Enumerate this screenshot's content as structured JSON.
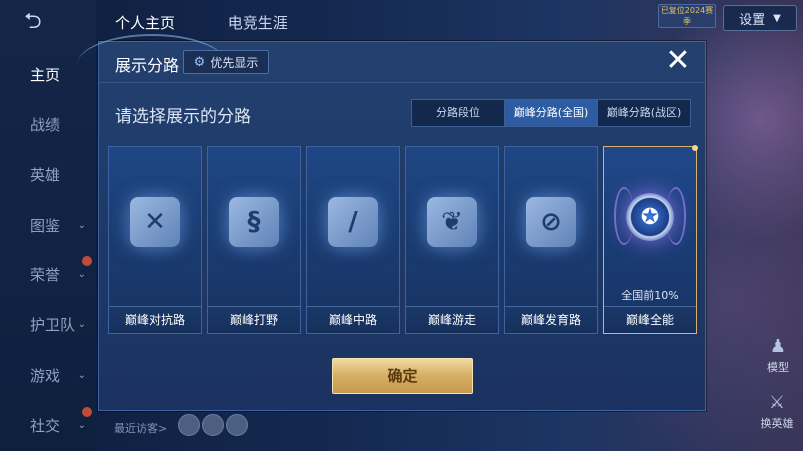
{
  "top_tabs": [
    "个人主页",
    "电竞生涯"
  ],
  "settings": {
    "label": "设置"
  },
  "badge": {
    "text": "已复位2024赛季"
  },
  "left_nav": [
    {
      "label": "主页",
      "active": true,
      "chevron": false,
      "badge": false
    },
    {
      "label": "战绩",
      "active": false,
      "chevron": false,
      "badge": false
    },
    {
      "label": "英雄",
      "active": false,
      "chevron": false,
      "badge": false
    },
    {
      "label": "图鉴",
      "active": false,
      "chevron": true,
      "badge": false
    },
    {
      "label": "荣誉",
      "active": false,
      "chevron": true,
      "badge": true
    },
    {
      "label": "护卫队",
      "active": false,
      "chevron": true,
      "badge": false
    },
    {
      "label": "游戏",
      "active": false,
      "chevron": true,
      "badge": false
    },
    {
      "label": "社交",
      "active": false,
      "chevron": true,
      "badge": true
    }
  ],
  "visitors": {
    "label": "最近访客>"
  },
  "side_buttons": {
    "model": "模型",
    "hero": "换英雄"
  },
  "modal": {
    "title": "展示分路",
    "priority_label": "优先显示",
    "subtitle": "请选择展示的分路",
    "segments": [
      {
        "label": "分路段位",
        "selected": false
      },
      {
        "label": "巅峰分路(全国)",
        "selected": true
      },
      {
        "label": "巅峰分路(战区)",
        "selected": false
      }
    ],
    "cards": [
      {
        "label": "巅峰对抗路",
        "icon": "sword-shield-icon",
        "selected": false
      },
      {
        "label": "巅峰打野",
        "icon": "dragon-icon",
        "selected": false
      },
      {
        "label": "巅峰中路",
        "icon": "staff-icon",
        "selected": false
      },
      {
        "label": "巅峰游走",
        "icon": "wings-icon",
        "selected": false
      },
      {
        "label": "巅峰发育路",
        "icon": "target-icon",
        "selected": false
      },
      {
        "label": "巅峰全能",
        "icon": "rank-emblem-icon",
        "selected": true,
        "percent": "全国前10%"
      }
    ],
    "confirm_label": "确定"
  },
  "colors": {
    "accent_gold": "#d8b26a",
    "segment_selected": "#2d5ca3",
    "modal_bg": "#1e3866"
  }
}
